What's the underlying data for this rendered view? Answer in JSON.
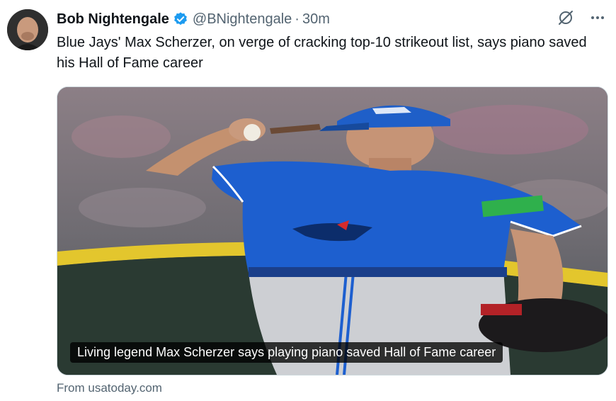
{
  "author": {
    "name": "Bob Nightengale",
    "handle": "@BNightengale",
    "separator": "·",
    "time": "30m",
    "verified": true
  },
  "icons": {
    "verified": "verified-badge-icon",
    "grok": "grok-icon",
    "more": "more-icon"
  },
  "tweet": {
    "text": "Blue Jays' Max Scherzer, on verge of cracking top-10 strikeout list, says piano saved his Hall of Fame career"
  },
  "card": {
    "title": "Living legend Max Scherzer says playing piano saved Hall of Fame career",
    "source": "From usatoday.com",
    "jersey_text": "BLUE JAYS"
  },
  "colors": {
    "verified": "#1d9bf0",
    "jersey": "#1d5fcf",
    "text_secondary": "#536471"
  }
}
